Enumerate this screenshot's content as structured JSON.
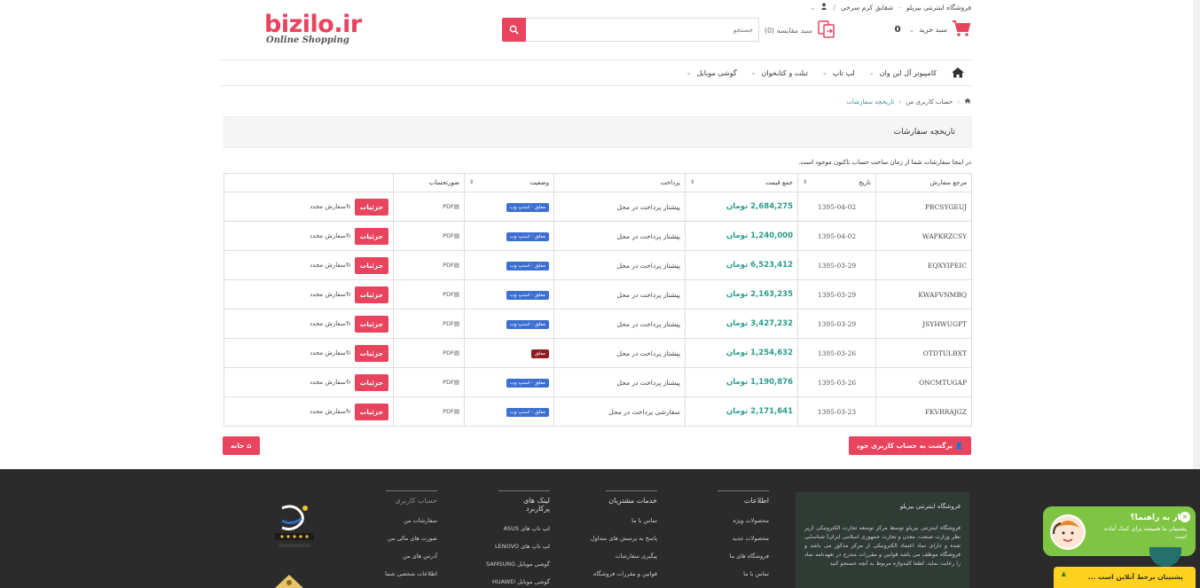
{
  "topbar": {
    "store_name": "فروشگاه اینترنتی بیزیلو",
    "user_name": "شقایق کرم سرخی",
    "user_icon": "user-icon"
  },
  "logo": {
    "big": "bizilo.ir",
    "small": "Online Shopping"
  },
  "search": {
    "placeholder": "جستجو",
    "icon": "search-icon"
  },
  "cart": {
    "label": "سبد خرید",
    "count": "0",
    "icon": "cart-icon"
  },
  "compare": {
    "label": "سبد مقایسه (0)",
    "icon": "compare-icon"
  },
  "nav": {
    "home_icon": "home-icon",
    "items": [
      {
        "label": "کامپیوتر آل این وان"
      },
      {
        "label": "لپ تاپ"
      },
      {
        "label": "تبلت و کتابخوان"
      },
      {
        "label": "گوشی موبایل"
      }
    ]
  },
  "breadcrumb": {
    "root": "حساب کاربری من",
    "current": "تاریخچه سفارشات"
  },
  "page": {
    "title": "تاریخچه سفارشات",
    "intro": "در اینجا سفارشات شما از زمان ساخت حساب تاکنون موجود است."
  },
  "table": {
    "headers": {
      "ref": "مرجع سفارش",
      "date": "تاریخ",
      "total": "جمع قیمت",
      "payment": "پرداخت",
      "status": "وضعیت",
      "invoice": "صورتحساب"
    },
    "details_label": "جزئیات",
    "reorder_label": "سفارش مجدد",
    "rows": [
      {
        "ref": "PBCSYGEUJ",
        "date": "1395-04-02",
        "total": "2,684,275 تومان",
        "payment": "پیشتاز پرداخت در محل",
        "status": "معلق - اسنپ وب",
        "status_type": "blue",
        "invoice": "PDF"
      },
      {
        "ref": "WAPKRZCSY",
        "date": "1395-04-02",
        "total": "1,240,000 تومان",
        "payment": "پیشتاز پرداخت در محل",
        "status": "معلق - اسنپ وب",
        "status_type": "blue",
        "invoice": "PDF"
      },
      {
        "ref": "EQXYIPEIC",
        "date": "1395-03-29",
        "total": "6,523,412 تومان",
        "payment": "پیشتاز پرداخت در محل",
        "status": "معلق - اسنپ وب",
        "status_type": "blue",
        "invoice": "PDF"
      },
      {
        "ref": "KWAFVNMBQ",
        "date": "1395-03-29",
        "total": "2,163,235 تومان",
        "payment": "پیشتاز پرداخت در محل",
        "status": "معلق - اسنپ وب",
        "status_type": "blue",
        "invoice": "PDF"
      },
      {
        "ref": "JSYHWUGPT",
        "date": "1395-03-29",
        "total": "3,427,232 تومان",
        "payment": "پیشتاز پرداخت در محل",
        "status": "معلق - اسنپ وب",
        "status_type": "blue",
        "invoice": "PDF"
      },
      {
        "ref": "OTDTULBXT",
        "date": "1395-03-26",
        "total": "1,254,632 تومان",
        "payment": "پیشتاز پرداخت در محل",
        "status": "معلق",
        "status_type": "dark",
        "invoice": "PDF"
      },
      {
        "ref": "ONCMTUGAP",
        "date": "1395-03-26",
        "total": "1,190,876 تومان",
        "payment": "پیشتاز پرداخت در محل",
        "status": "معلق - اسنپ وب",
        "status_type": "blue",
        "invoice": "PDF"
      },
      {
        "ref": "FKVRRAJGZ",
        "date": "1395-03-23",
        "total": "2,171,641 تومان",
        "payment": "سفارشی پرداخت در محل",
        "status": "معلق - اسنپ وب",
        "status_type": "blue",
        "invoice": "PDF"
      }
    ]
  },
  "buttons": {
    "back": "برگشت به حساب کاربری خود",
    "home": "خانه"
  },
  "footer": {
    "about_title": "فروشگاه اینترنتی بیزیلو",
    "about_text": "فروشگاه اینترنتی بیزیلو توسط مرکز توسعه تجارت الکترونیکی (زیر نظر وزارت صنعت، معدن و تجارت جمهوری اسلامی ایران) شناسایی شده و دارای نماد اعتماد الکترونیکی از مرکز مذکور می باشد و فروشگاه موظف می باشد قوانین و مقررات مندرج در تعهدنامه نماد را رعایت نماید. لطفا کلیدواژه مربوط به آنچه جستجو کنید",
    "columns": [
      {
        "title": "اطلاعات",
        "links": [
          "محصولات ویژه",
          "محصولات جدید",
          "فروشگاه های ما",
          "تماس با ما"
        ]
      },
      {
        "title": "خدمات مشتریان",
        "links": [
          "تماس با ما",
          "پاسخ به پرسش های متداول",
          "پیگیری سفارشات",
          "قوانین و مقررات فروشگاه"
        ]
      },
      {
        "title": "لینک های پرکاربرد",
        "links": [
          "لپ تاپ های ASUS",
          "لپ تاپ های LENOVO",
          "گوشی موبایل SAMSUNG",
          "گوشی موبایل HUAWEI"
        ]
      },
      {
        "title": "حساب کاربری",
        "links": [
          "سفارشات من",
          "صورت های مالی من",
          "آدرس های من",
          "اطلاعات شخصی شما"
        ]
      }
    ]
  },
  "help": {
    "title": "نیاز به راهنما؟",
    "text": "پشتیبان ما همیشه برای کمک آماده است",
    "online": "پشتیبان برخط آنلاین است ..."
  }
}
